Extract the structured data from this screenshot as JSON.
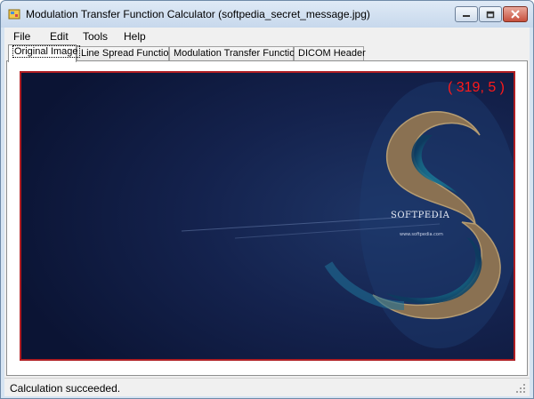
{
  "window": {
    "title": "Modulation Transfer Function Calculator (softpedia_secret_message.jpg)",
    "icons": {
      "app": "app-icon",
      "minimize": "minimize-icon",
      "maximize": "maximize-icon",
      "close": "close-icon"
    }
  },
  "menu": {
    "items": [
      {
        "label": "File"
      },
      {
        "label": "Edit"
      },
      {
        "label": "Tools"
      },
      {
        "label": "Help"
      }
    ]
  },
  "tabs": [
    {
      "label": "Original Image",
      "active": true
    },
    {
      "label": "Line Spread Function",
      "active": false
    },
    {
      "label": "Modulation Transfer Function",
      "active": false
    },
    {
      "label": "DICOM Header",
      "active": false
    }
  ],
  "image": {
    "coordinate_readout": "( 319, 5 )",
    "watermark_text": "SOFTPEDIA",
    "watermark_url": "www.softpedia.com",
    "colors": {
      "background": "#101a3f",
      "frame": "#b01e23",
      "readout": "#ff1a1a"
    }
  },
  "status": {
    "text": "Calculation succeeded."
  }
}
